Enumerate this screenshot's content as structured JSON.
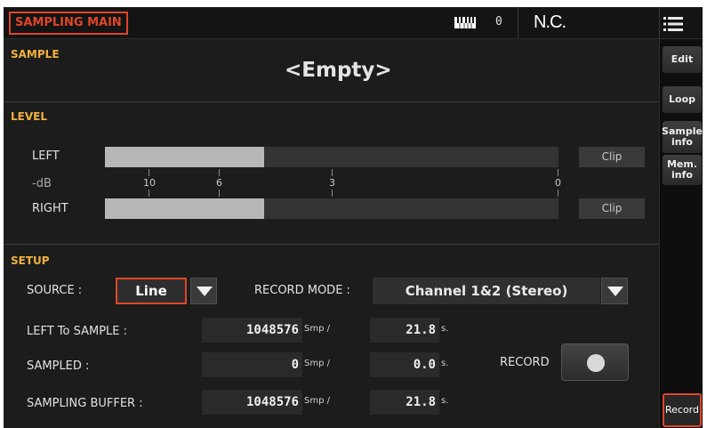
{
  "header": {
    "title": "SAMPLING MAIN",
    "keyboard_value": "0",
    "chord": "N.C."
  },
  "tabs": {
    "edit": "Edit",
    "loop": "Loop",
    "sample_info": "Sample info",
    "mem_info": "Mem. info",
    "record": "Record"
  },
  "sample": {
    "label": "SAMPLE",
    "name": "<Empty>"
  },
  "level": {
    "label": "LEVEL",
    "left_label": "LEFT",
    "right_label": "RIGHT",
    "db_label": "-dB",
    "scale": [
      "10",
      "6",
      "3",
      "0"
    ],
    "clip_label": "Clip",
    "left_level": 0.35,
    "right_level": 0.35
  },
  "setup": {
    "label": "SETUP",
    "source_label": "SOURCE :",
    "source_value": "Line",
    "record_mode_label": "RECORD MODE :",
    "record_mode_value": "Channel 1&2 (Stereo)",
    "left_to_sample_label": "LEFT To SAMPLE :",
    "left_to_sample_smp": "1048576",
    "left_to_sample_sec": "21.8",
    "sampled_label": "SAMPLED :",
    "sampled_smp": "0",
    "sampled_sec": "0.0",
    "sampling_buffer_label": "SAMPLING BUFFER :",
    "sampling_buffer_smp": "1048576",
    "sampling_buffer_sec": "21.8",
    "smp_unit": "Smp /",
    "sec_unit": "s.",
    "record_label": "RECORD"
  },
  "colors": {
    "accent": "#e0452a",
    "section_label": "#f0b23c",
    "background": "#1c1c1c"
  }
}
